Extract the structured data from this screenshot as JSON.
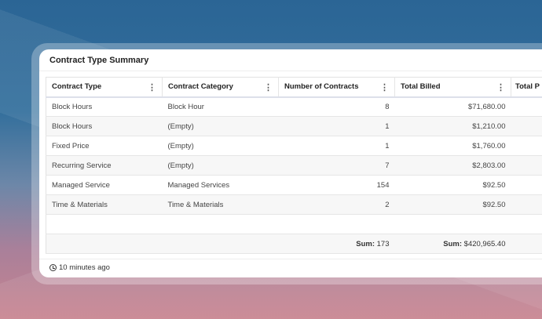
{
  "widget": {
    "title": "Contract Type Summary",
    "updated": "10 minutes ago"
  },
  "columns": [
    "Contract Type",
    "Contract Category",
    "Number of Contracts",
    "Total Billed",
    "Total P"
  ],
  "rows": [
    [
      "Block Hours",
      "Block Hour",
      "8",
      "$71,680.00"
    ],
    [
      "Block Hours",
      "(Empty)",
      "1",
      "$1,210.00"
    ],
    [
      "Fixed Price",
      "(Empty)",
      "1",
      "$1,760.00"
    ],
    [
      "Recurring Service",
      "(Empty)",
      "7",
      "$2,803.00"
    ],
    [
      "Managed Service",
      "Managed Services",
      "154",
      "$92.50"
    ],
    [
      "Time & Materials",
      "Time & Materials",
      "2",
      "$92.50"
    ]
  ],
  "summary": {
    "label": "Sum:",
    "contracts": "173",
    "billed": "$420,965.40"
  }
}
